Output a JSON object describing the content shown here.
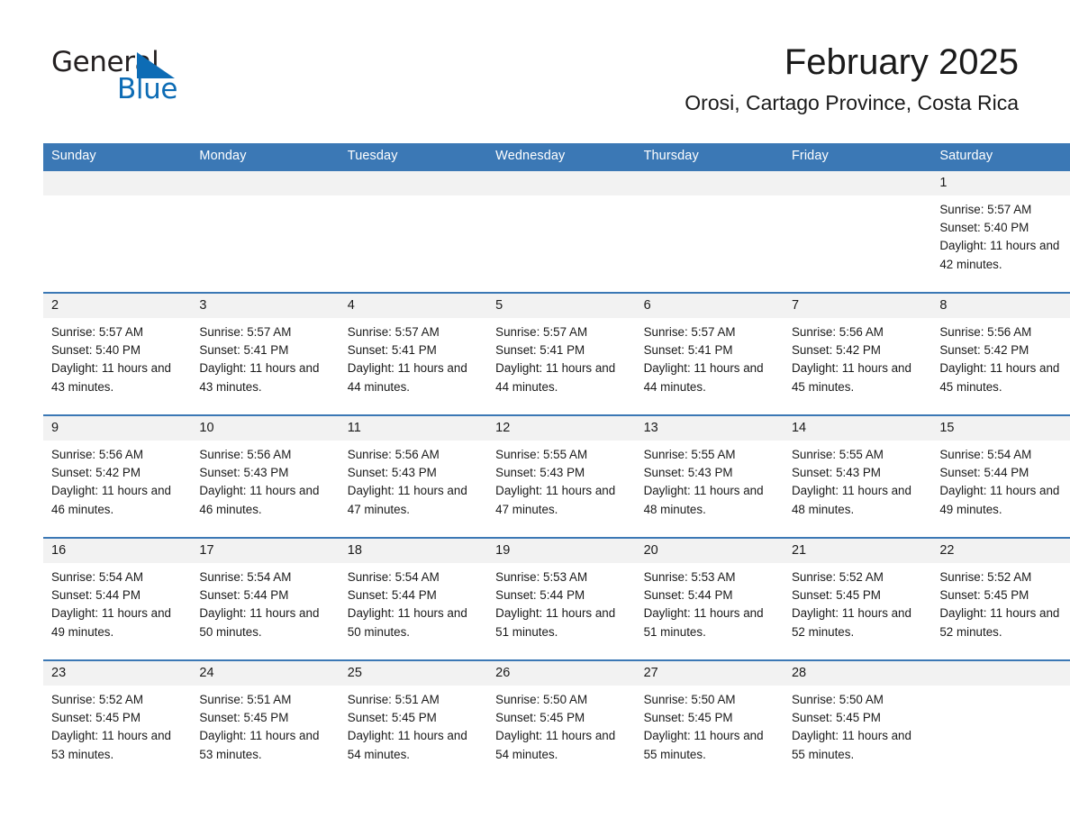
{
  "brand": {
    "name_part1": "General",
    "name_part2": "Blue"
  },
  "header": {
    "title": "February 2025",
    "subtitle": "Orosi, Cartago Province, Costa Rica"
  },
  "colors": {
    "header_blue": "#3b78b5",
    "logo_blue": "#0d6cb5",
    "daynum_bg": "#f2f2f2",
    "text": "#1a1a1a"
  },
  "weekday_headers": [
    "Sunday",
    "Monday",
    "Tuesday",
    "Wednesday",
    "Thursday",
    "Friday",
    "Saturday"
  ],
  "weeks": [
    [
      {
        "day": "",
        "blank": true
      },
      {
        "day": "",
        "blank": true
      },
      {
        "day": "",
        "blank": true
      },
      {
        "day": "",
        "blank": true
      },
      {
        "day": "",
        "blank": true
      },
      {
        "day": "",
        "blank": true
      },
      {
        "day": "1",
        "sunrise": "Sunrise: 5:57 AM",
        "sunset": "Sunset: 5:40 PM",
        "daylight": "Daylight: 11 hours and 42 minutes."
      }
    ],
    [
      {
        "day": "2",
        "sunrise": "Sunrise: 5:57 AM",
        "sunset": "Sunset: 5:40 PM",
        "daylight": "Daylight: 11 hours and 43 minutes."
      },
      {
        "day": "3",
        "sunrise": "Sunrise: 5:57 AM",
        "sunset": "Sunset: 5:41 PM",
        "daylight": "Daylight: 11 hours and 43 minutes."
      },
      {
        "day": "4",
        "sunrise": "Sunrise: 5:57 AM",
        "sunset": "Sunset: 5:41 PM",
        "daylight": "Daylight: 11 hours and 44 minutes."
      },
      {
        "day": "5",
        "sunrise": "Sunrise: 5:57 AM",
        "sunset": "Sunset: 5:41 PM",
        "daylight": "Daylight: 11 hours and 44 minutes."
      },
      {
        "day": "6",
        "sunrise": "Sunrise: 5:57 AM",
        "sunset": "Sunset: 5:41 PM",
        "daylight": "Daylight: 11 hours and 44 minutes."
      },
      {
        "day": "7",
        "sunrise": "Sunrise: 5:56 AM",
        "sunset": "Sunset: 5:42 PM",
        "daylight": "Daylight: 11 hours and 45 minutes."
      },
      {
        "day": "8",
        "sunrise": "Sunrise: 5:56 AM",
        "sunset": "Sunset: 5:42 PM",
        "daylight": "Daylight: 11 hours and 45 minutes."
      }
    ],
    [
      {
        "day": "9",
        "sunrise": "Sunrise: 5:56 AM",
        "sunset": "Sunset: 5:42 PM",
        "daylight": "Daylight: 11 hours and 46 minutes."
      },
      {
        "day": "10",
        "sunrise": "Sunrise: 5:56 AM",
        "sunset": "Sunset: 5:43 PM",
        "daylight": "Daylight: 11 hours and 46 minutes."
      },
      {
        "day": "11",
        "sunrise": "Sunrise: 5:56 AM",
        "sunset": "Sunset: 5:43 PM",
        "daylight": "Daylight: 11 hours and 47 minutes."
      },
      {
        "day": "12",
        "sunrise": "Sunrise: 5:55 AM",
        "sunset": "Sunset: 5:43 PM",
        "daylight": "Daylight: 11 hours and 47 minutes."
      },
      {
        "day": "13",
        "sunrise": "Sunrise: 5:55 AM",
        "sunset": "Sunset: 5:43 PM",
        "daylight": "Daylight: 11 hours and 48 minutes."
      },
      {
        "day": "14",
        "sunrise": "Sunrise: 5:55 AM",
        "sunset": "Sunset: 5:43 PM",
        "daylight": "Daylight: 11 hours and 48 minutes."
      },
      {
        "day": "15",
        "sunrise": "Sunrise: 5:54 AM",
        "sunset": "Sunset: 5:44 PM",
        "daylight": "Daylight: 11 hours and 49 minutes."
      }
    ],
    [
      {
        "day": "16",
        "sunrise": "Sunrise: 5:54 AM",
        "sunset": "Sunset: 5:44 PM",
        "daylight": "Daylight: 11 hours and 49 minutes."
      },
      {
        "day": "17",
        "sunrise": "Sunrise: 5:54 AM",
        "sunset": "Sunset: 5:44 PM",
        "daylight": "Daylight: 11 hours and 50 minutes."
      },
      {
        "day": "18",
        "sunrise": "Sunrise: 5:54 AM",
        "sunset": "Sunset: 5:44 PM",
        "daylight": "Daylight: 11 hours and 50 minutes."
      },
      {
        "day": "19",
        "sunrise": "Sunrise: 5:53 AM",
        "sunset": "Sunset: 5:44 PM",
        "daylight": "Daylight: 11 hours and 51 minutes."
      },
      {
        "day": "20",
        "sunrise": "Sunrise: 5:53 AM",
        "sunset": "Sunset: 5:44 PM",
        "daylight": "Daylight: 11 hours and 51 minutes."
      },
      {
        "day": "21",
        "sunrise": "Sunrise: 5:52 AM",
        "sunset": "Sunset: 5:45 PM",
        "daylight": "Daylight: 11 hours and 52 minutes."
      },
      {
        "day": "22",
        "sunrise": "Sunrise: 5:52 AM",
        "sunset": "Sunset: 5:45 PM",
        "daylight": "Daylight: 11 hours and 52 minutes."
      }
    ],
    [
      {
        "day": "23",
        "sunrise": "Sunrise: 5:52 AM",
        "sunset": "Sunset: 5:45 PM",
        "daylight": "Daylight: 11 hours and 53 minutes."
      },
      {
        "day": "24",
        "sunrise": "Sunrise: 5:51 AM",
        "sunset": "Sunset: 5:45 PM",
        "daylight": "Daylight: 11 hours and 53 minutes."
      },
      {
        "day": "25",
        "sunrise": "Sunrise: 5:51 AM",
        "sunset": "Sunset: 5:45 PM",
        "daylight": "Daylight: 11 hours and 54 minutes."
      },
      {
        "day": "26",
        "sunrise": "Sunrise: 5:50 AM",
        "sunset": "Sunset: 5:45 PM",
        "daylight": "Daylight: 11 hours and 54 minutes."
      },
      {
        "day": "27",
        "sunrise": "Sunrise: 5:50 AM",
        "sunset": "Sunset: 5:45 PM",
        "daylight": "Daylight: 11 hours and 55 minutes."
      },
      {
        "day": "28",
        "sunrise": "Sunrise: 5:50 AM",
        "sunset": "Sunset: 5:45 PM",
        "daylight": "Daylight: 11 hours and 55 minutes."
      },
      {
        "day": "",
        "blank": true
      }
    ]
  ]
}
